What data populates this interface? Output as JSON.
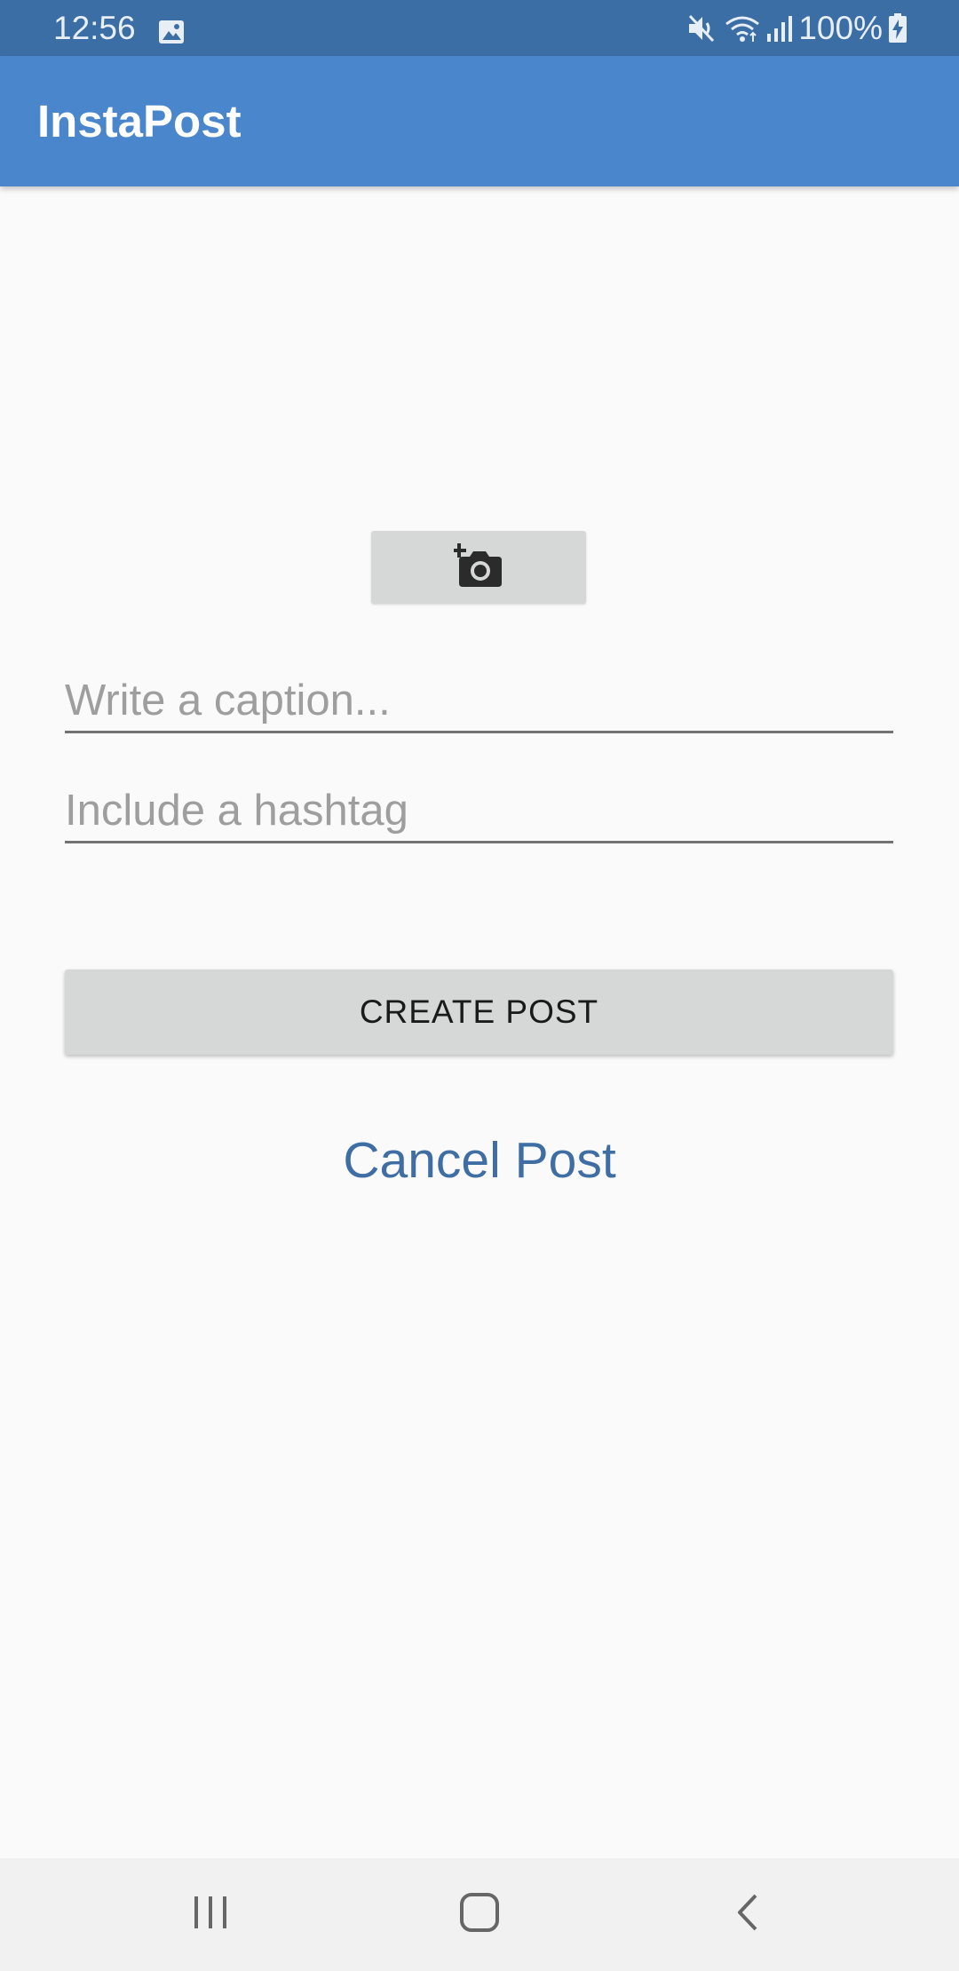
{
  "status_bar": {
    "time": "12:56",
    "battery": "100%",
    "icons": [
      "gallery-icon",
      "mute-icon",
      "wifi-icon",
      "signal-icon",
      "battery-charging-icon"
    ]
  },
  "app_bar": {
    "title": "InstaPost"
  },
  "form": {
    "photo_button_icon": "add-photo-camera-icon",
    "caption_placeholder": "Write a caption...",
    "caption_value": "",
    "hashtag_placeholder": "Include a hashtag",
    "hashtag_value": "",
    "create_button_label": "CREATE POST",
    "cancel_label": "Cancel Post"
  },
  "nav_bar": {
    "icons": [
      "recent-apps-icon",
      "home-icon",
      "back-icon"
    ]
  },
  "colors": {
    "status_bar": "#3C6EA6",
    "app_bar": "#4A86CC",
    "background": "#FAFAFA",
    "button": "#D6D7D7",
    "link": "#3F6EA5"
  }
}
